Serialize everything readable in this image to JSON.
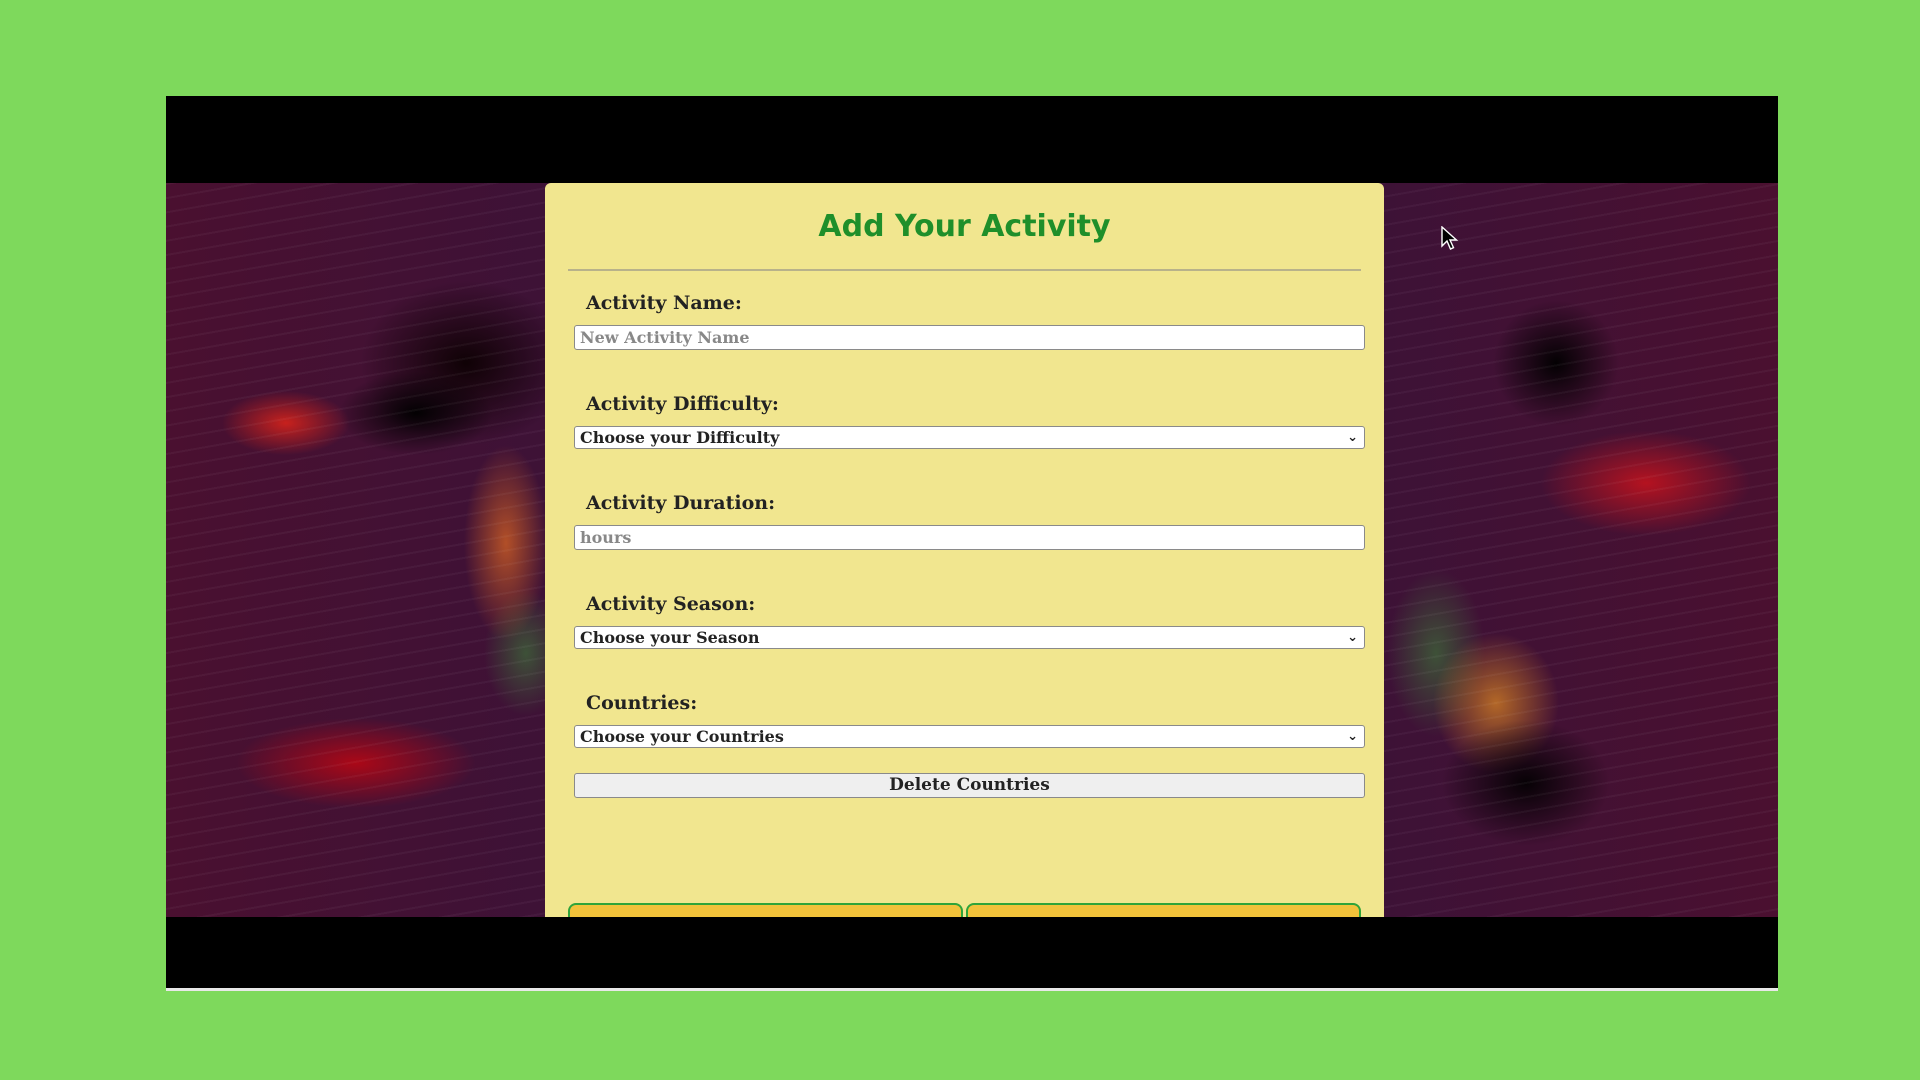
{
  "form": {
    "title": "Add Your Activity",
    "name_label": "Activity Name:",
    "name_placeholder": "New Activity Name",
    "difficulty_label": "Activity Difficulty:",
    "difficulty_selected": "Choose your Difficulty",
    "duration_label": "Activity Duration:",
    "duration_placeholder": "hours",
    "season_label": "Activity Season:",
    "season_selected": "Choose your Season",
    "countries_label": "Countries:",
    "countries_selected": "Choose your Countries",
    "delete_countries_label": "Delete Countries"
  },
  "icons": {
    "dropdown": "chevron-down-icon",
    "cursor": "mouse-pointer-icon"
  },
  "colors": {
    "page_background": "#7ed95c",
    "card_background": "#f1e68f",
    "title_color": "#1f8f2a",
    "bottom_button_fill": "#f2c23a",
    "bottom_button_border": "#2fa43a"
  }
}
